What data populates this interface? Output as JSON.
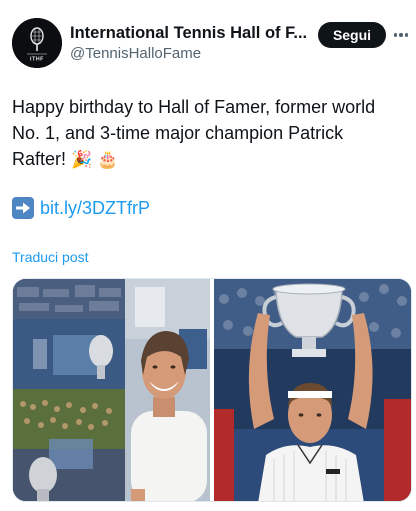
{
  "account": {
    "display_name": "International Tennis Hall of F...",
    "handle": "@TennisHalloFame",
    "avatar_text": "ITHF",
    "follow_label": "Segui"
  },
  "tweet": {
    "line1": "Happy birthday to Hall of Famer, former world",
    "line2": "No. 1, and 3-time major champion Patrick",
    "line3": "Rafter!",
    "emoji_party": "🎉",
    "emoji_cake": "🎂",
    "link_text": "bit.ly/3DZTfrP",
    "translate_label": "Traduci post"
  },
  "media": {
    "left_alt": "Patrick Rafter smiling in white t-shirt in front of trophy display",
    "right_alt": "Patrick Rafter holding the US Open trophy above his head"
  },
  "colors": {
    "link": "#1d9bf0",
    "text": "#0f1419",
    "secondary": "#536471",
    "follow_bg": "#0f1419"
  }
}
